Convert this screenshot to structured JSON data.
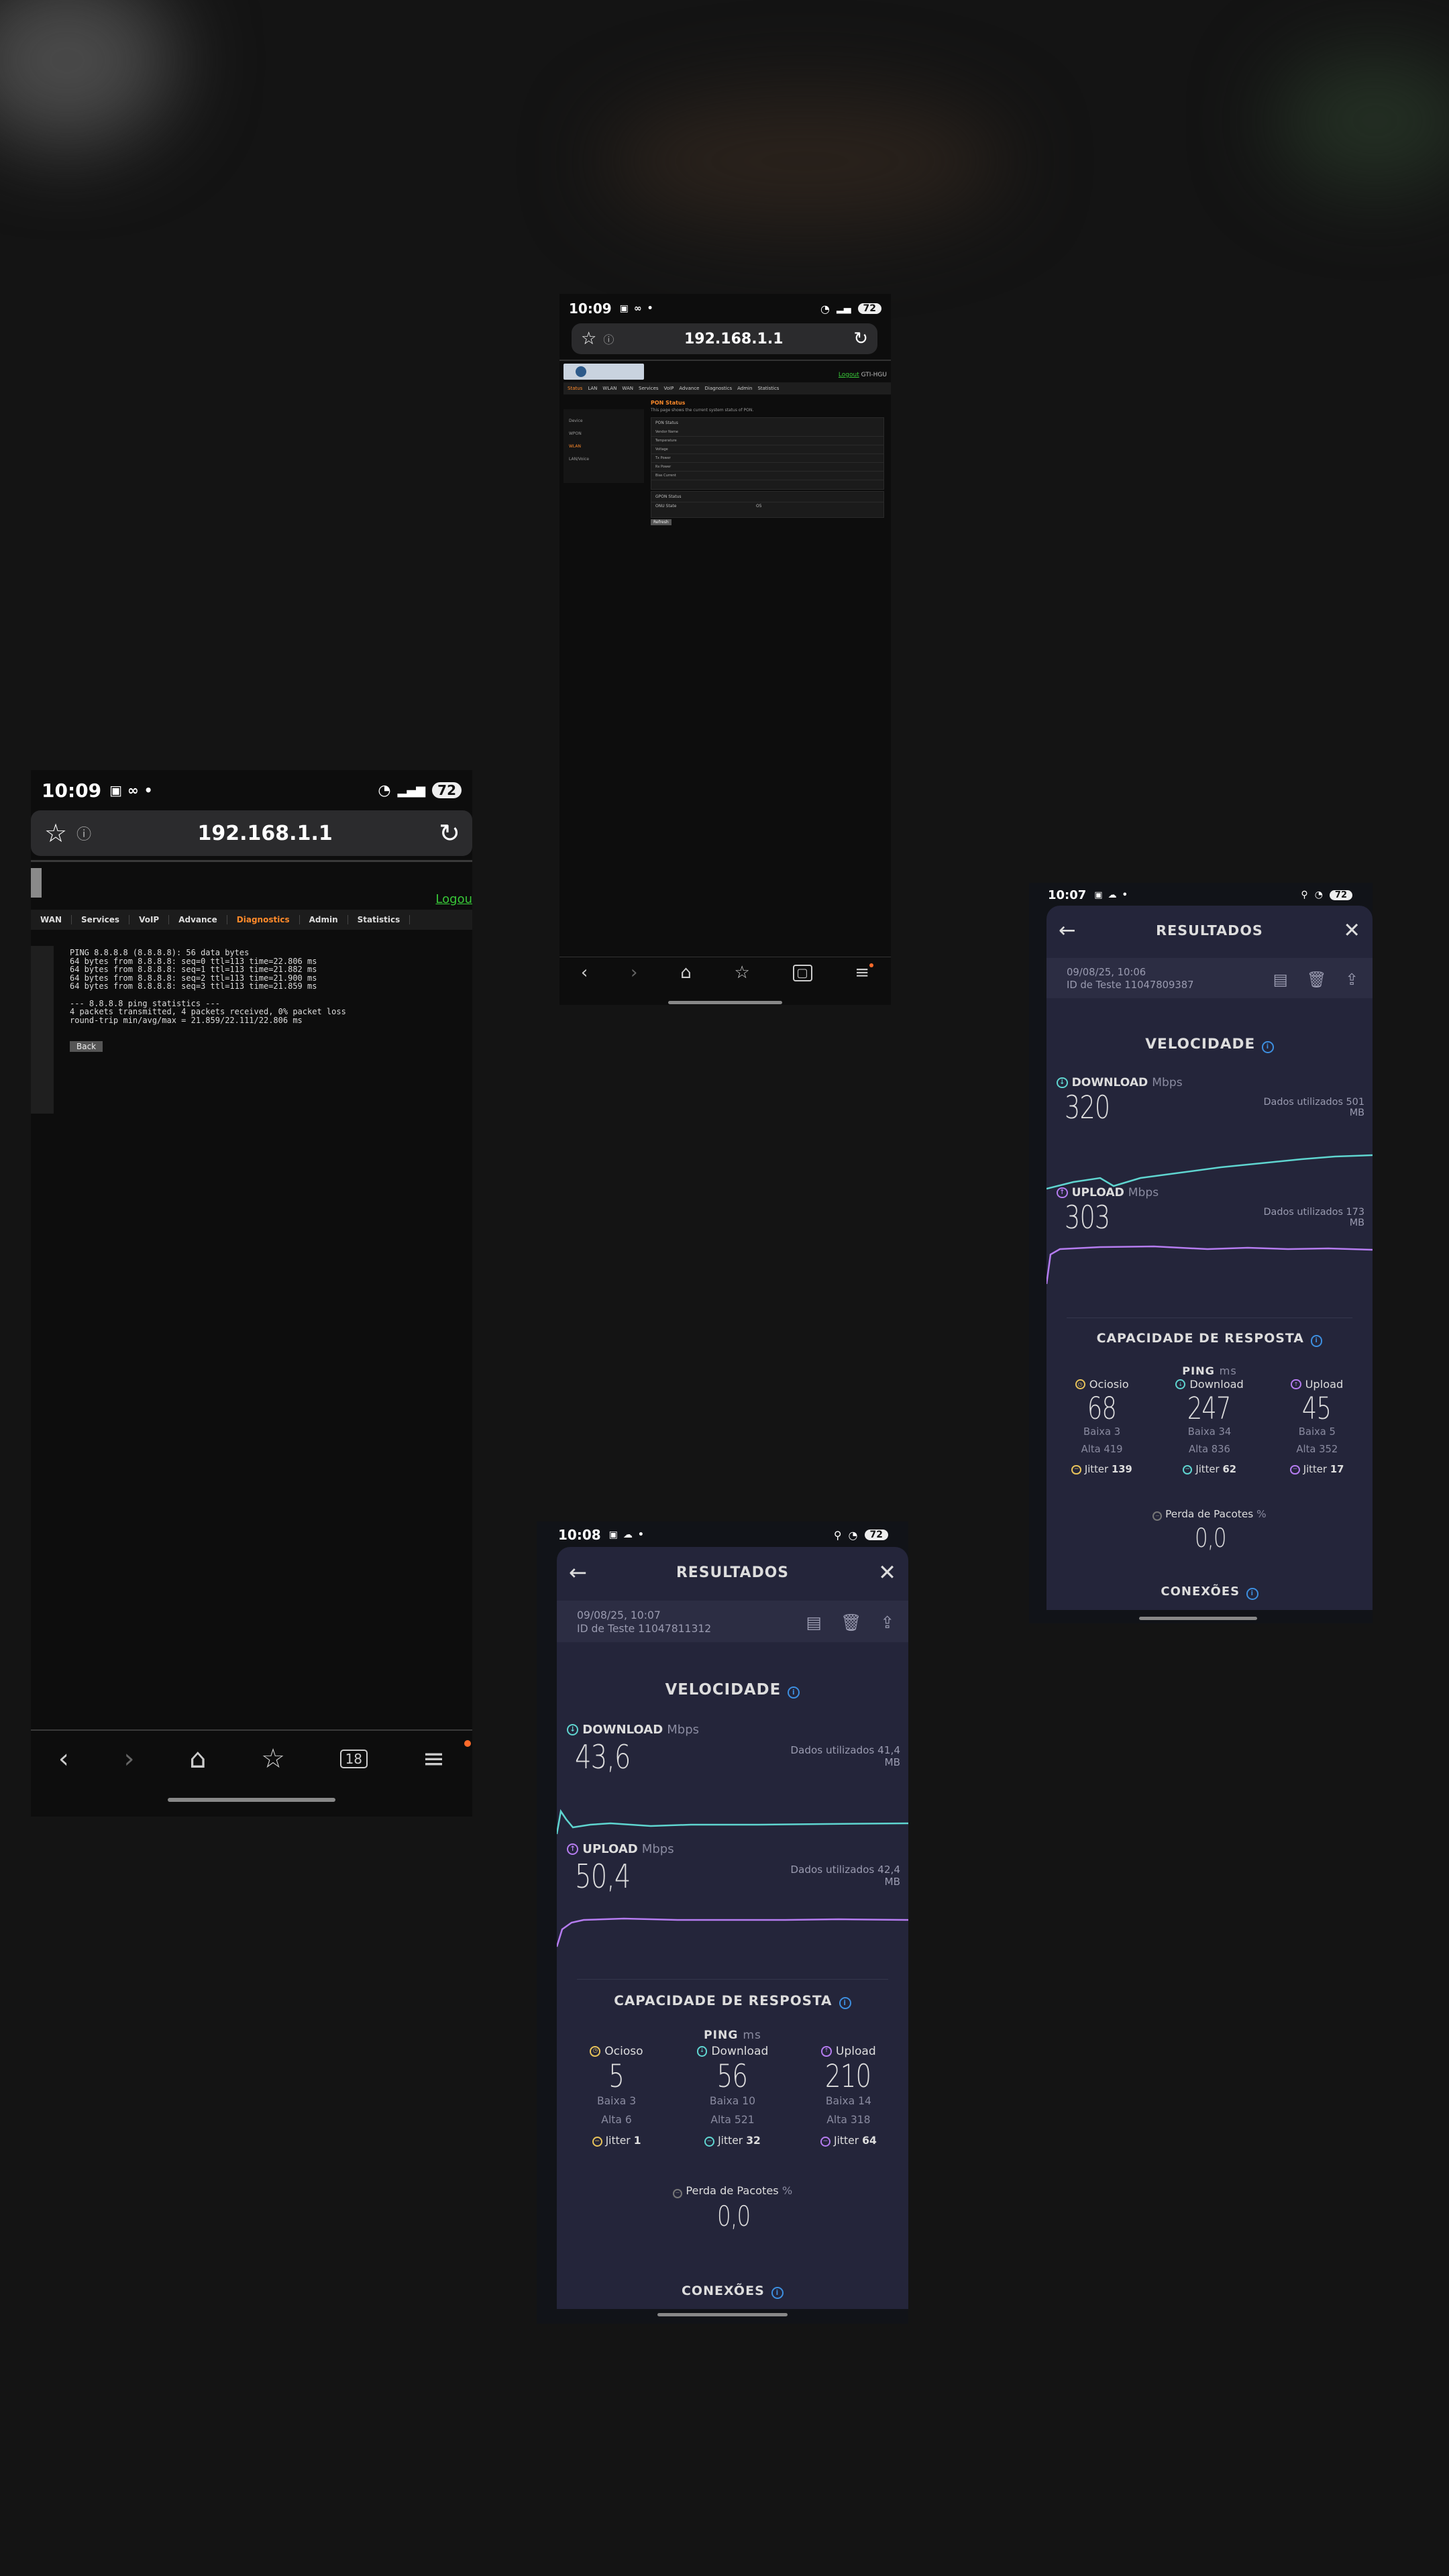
{
  "phone_top": {
    "time": "10:09",
    "battery": "72",
    "url": "192.168.1.1",
    "logout": "Logout",
    "user": "GTI-HGU",
    "tabs": [
      "Status",
      "LAN",
      "WLAN",
      "WAN",
      "Services",
      "VoIP",
      "Advance",
      "Diagnostics",
      "Admin",
      "Statistics"
    ],
    "side_items": [
      "Device",
      "WPON",
      "WLAN",
      "LAN/Voice"
    ],
    "section_title": "PON Status",
    "section_desc": "This page shows the current system status of PON.",
    "rows": [
      [
        "Vendor Name",
        ""
      ],
      [
        "Temperature",
        ""
      ],
      [
        "Voltage",
        ""
      ],
      [
        "Tx Power",
        ""
      ],
      [
        "Rx Power",
        ""
      ],
      [
        "Bias Current",
        ""
      ]
    ],
    "gpon_title": "GPON Status",
    "onu_label": "ONU State",
    "refresh_label": "Refresh"
  },
  "phone_left": {
    "time": "10:09",
    "battery": "72",
    "url": "192.168.1.1",
    "logout": "Logou",
    "tabs": [
      {
        "label": "WAN",
        "active": false
      },
      {
        "label": "Services",
        "active": false
      },
      {
        "label": "VoIP",
        "active": false
      },
      {
        "label": "Advance",
        "active": false
      },
      {
        "label": "Diagnostics",
        "active": true
      },
      {
        "label": "Admin",
        "active": false
      },
      {
        "label": "Statistics",
        "active": false
      }
    ],
    "ping_output": [
      "PING 8.8.8.8 (8.8.8.8): 56 data bytes",
      "64 bytes from 8.8.8.8: seq=0 ttl=113 time=22.806 ms",
      "64 bytes from 8.8.8.8: seq=1 ttl=113 time=21.882 ms",
      "64 bytes from 8.8.8.8: seq=2 ttl=113 time=21.900 ms",
      "64 bytes from 8.8.8.8: seq=3 ttl=113 time=21.859 ms",
      "",
      "--- 8.8.8.8 ping statistics ---",
      "4 packets transmitted, 4 packets received, 0% packet loss",
      "round-trip min/avg/max = 21.859/22.111/22.806 ms"
    ],
    "back_label": "Back",
    "tabs_count": "18"
  },
  "speed_right": {
    "time": "10:07",
    "battery": "72",
    "title": "RESULTADOS",
    "date": "09/08/25, 10:06",
    "test_id": "ID de Teste 11047809387",
    "speed_title": "VELOCIDADE",
    "download_label": "DOWNLOAD",
    "upload_label": "UPLOAD",
    "unit_mbps": "Mbps",
    "download_value": "320",
    "upload_value": "303",
    "download_used": "Dados utilizados 501 MB",
    "upload_used": "Dados utilizados 173 MB",
    "response_title": "CAPACIDADE DE RESPOSTA",
    "ping_label": "PING",
    "unit_ms": "ms",
    "ping": [
      {
        "label": "Ociosio",
        "value": "68",
        "low": "3",
        "high": "419",
        "jitter": "139",
        "color": "#e8c35a"
      },
      {
        "label": "Download",
        "value": "247",
        "low": "34",
        "high": "836",
        "jitter": "62",
        "color": "#5fd5d0"
      },
      {
        "label": "Upload",
        "value": "45",
        "low": "5",
        "high": "352",
        "jitter": "17",
        "color": "#b57cf0"
      }
    ],
    "low_label": "Baixa",
    "high_label": "Alta",
    "jitter_label": "Jitter",
    "loss_label": "Perda de Pacotes",
    "loss_unit": "%",
    "loss_value": "0,0",
    "connections_title": "CONEXÕES"
  },
  "speed_bottom": {
    "time": "10:08",
    "battery": "72",
    "title": "RESULTADOS",
    "date": "09/08/25, 10:07",
    "test_id": "ID de Teste 11047811312",
    "speed_title": "VELOCIDADE",
    "download_label": "DOWNLOAD",
    "upload_label": "UPLOAD",
    "unit_mbps": "Mbps",
    "download_value": "43,6",
    "upload_value": "50,4",
    "download_used": "Dados utilizados 41,4 MB",
    "upload_used": "Dados utilizados 42,4 MB",
    "response_title": "CAPACIDADE DE RESPOSTA",
    "ping_label": "PING",
    "unit_ms": "ms",
    "ping": [
      {
        "label": "Ocioso",
        "value": "5",
        "low": "3",
        "high": "6",
        "jitter": "1",
        "color": "#e8c35a"
      },
      {
        "label": "Download",
        "value": "56",
        "low": "10",
        "high": "521",
        "jitter": "32",
        "color": "#5fd5d0"
      },
      {
        "label": "Upload",
        "value": "210",
        "low": "14",
        "high": "318",
        "jitter": "64",
        "color": "#b57cf0"
      }
    ],
    "low_label": "Baixa",
    "high_label": "Alta",
    "jitter_label": "Jitter",
    "loss_label": "Perda de Pacotes",
    "loss_unit": "%",
    "loss_value": "0,0",
    "connections_title": "CONEXÕES"
  },
  "colors": {
    "download": "#5fd5d0",
    "upload": "#b57cf0",
    "idle": "#e8c35a",
    "accent_orange": "#ff8a2a",
    "logout_green": "#38c838",
    "info_blue": "#3d8fe0"
  }
}
